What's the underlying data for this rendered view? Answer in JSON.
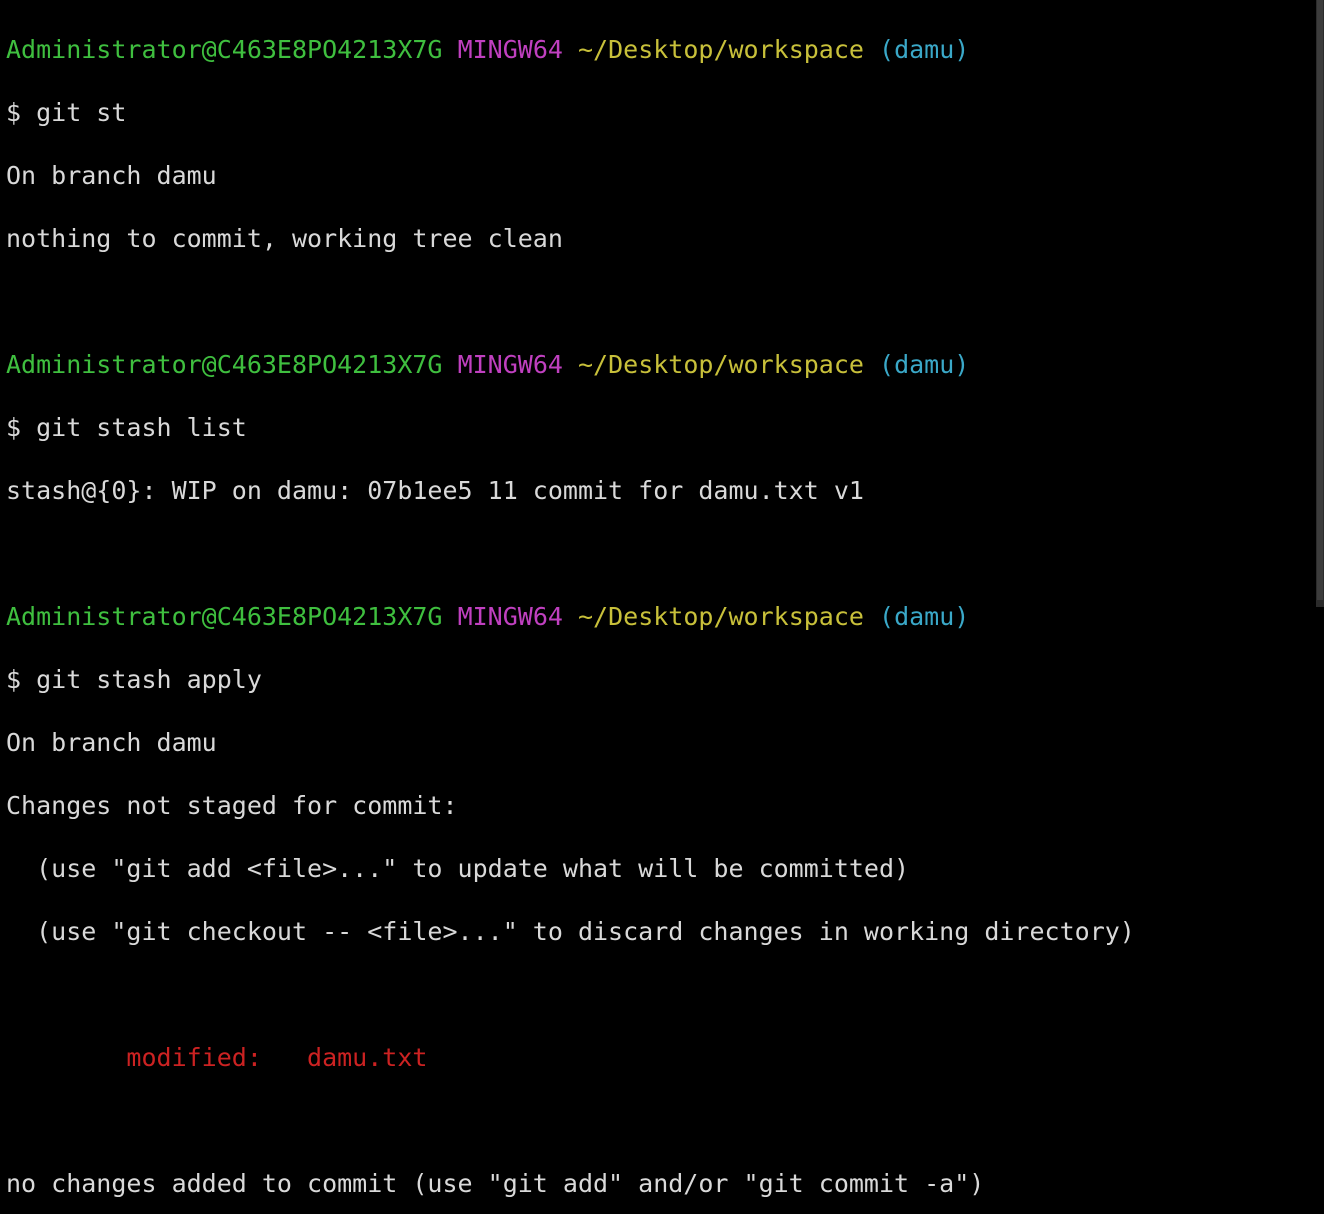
{
  "prompts": [
    {
      "user": "Administrator@C463E8PO4213X7G",
      "shell": "MINGW64",
      "path": "~/Desktop/workspace",
      "branch": "(damu)"
    },
    {
      "user": "Administrator@C463E8PO4213X7G",
      "shell": "MINGW64",
      "path": "~/Desktop/workspace",
      "branch": "(damu)"
    },
    {
      "user": "Administrator@C463E8PO4213X7G",
      "shell": "MINGW64",
      "path": "~/Desktop/workspace",
      "branch": "(damu)"
    }
  ],
  "commands": [
    "$ git st",
    "$ git stash list",
    "$ git stash apply"
  ],
  "outputs": {
    "status": [
      "On branch damu",
      "nothing to commit, working tree clean"
    ],
    "stash_list": [
      "stash@{0}: WIP on damu: 07b1ee5 11 commit for damu.txt v1"
    ],
    "apply": {
      "branch_line": "On branch damu",
      "changes_header": "Changes not staged for commit:",
      "hint_add": "  (use \"git add <file>...\" to update what will be committed)",
      "hint_checkout": "  (use \"git checkout -- <file>...\" to discard changes in working directory)",
      "modified_label": "        modified:   ",
      "modified_file": "damu.txt",
      "footer": "no changes added to commit (use \"git add\" and/or \"git commit -a\")"
    }
  },
  "colors": {
    "background": "#000000",
    "text": "#d9d9d9",
    "user": "#3fbf3f",
    "shell": "#c040c0",
    "path": "#c8c03a",
    "branch": "#3aa8c8",
    "modified": "#cc2222"
  }
}
